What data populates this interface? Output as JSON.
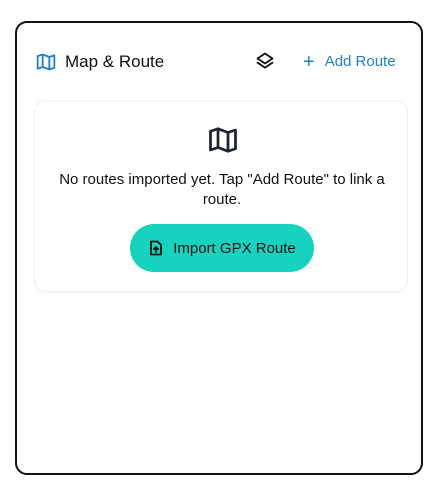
{
  "header": {
    "title": "Map & Route",
    "add_route_icon": "plus",
    "add_route_label": "Add Route",
    "layers_icon": "layers-icon",
    "title_icon": "map-icon"
  },
  "empty_state": {
    "icon": "map-icon",
    "message": "No routes imported yet. Tap \"Add Route\" to link a route.",
    "import_button_label": "Import GPX Route",
    "import_button_icon": "file-upload-icon"
  },
  "colors": {
    "accent_blue": "#1f80c8",
    "teal_button": "#16d3bf",
    "text": "#111111",
    "border": "#111111"
  }
}
